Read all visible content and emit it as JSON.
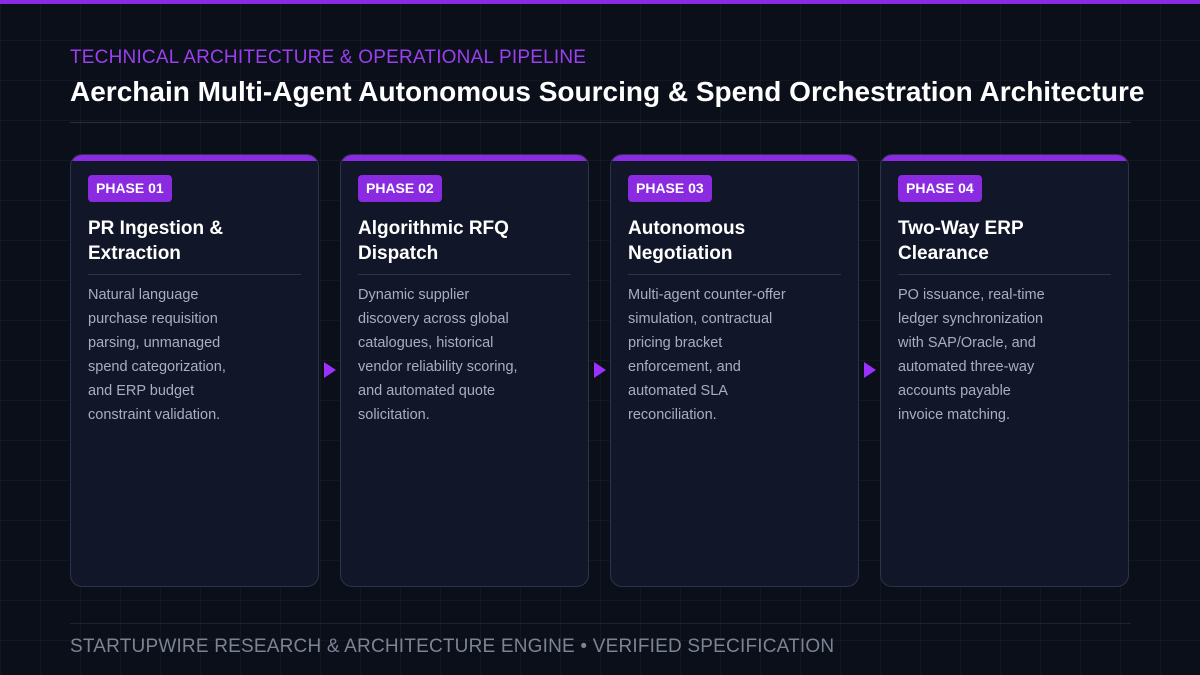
{
  "header": {
    "eyebrow": "TECHNICAL ARCHITECTURE & OPERATIONAL PIPELINE",
    "title": "Aerchain Multi-Agent Autonomous Sourcing & Spend Orchestration Architecture"
  },
  "phases": [
    {
      "badge": "PHASE 01",
      "title": "PR Ingestion & Extraction",
      "description": "Natural language purchase requisition parsing, unmanaged spend categorization, and ERP budget constraint validation."
    },
    {
      "badge": "PHASE 02",
      "title": "Algorithmic RFQ Dispatch",
      "description": "Dynamic supplier discovery across global catalogues, historical vendor reliability scoring, and automated quote solicitation."
    },
    {
      "badge": "PHASE 03",
      "title": "Autonomous Negotiation",
      "description": "Multi-agent counter-offer simulation, contractual pricing bracket enforcement, and automated SLA reconciliation."
    },
    {
      "badge": "PHASE 04",
      "title": "Two-Way ERP Clearance",
      "description": "PO issuance, real-time ledger synchronization with SAP/Oracle, and automated three-way accounts payable invoice matching."
    }
  ],
  "footer": {
    "text": "STARTUPWIRE RESEARCH & ARCHITECTURE ENGINE  •  VERIFIED SPECIFICATION"
  },
  "colors": {
    "accent": "#8a2be2",
    "background": "#0b0f1a",
    "card": "#111729"
  },
  "icons": {
    "connector": "arrow-right-icon"
  }
}
